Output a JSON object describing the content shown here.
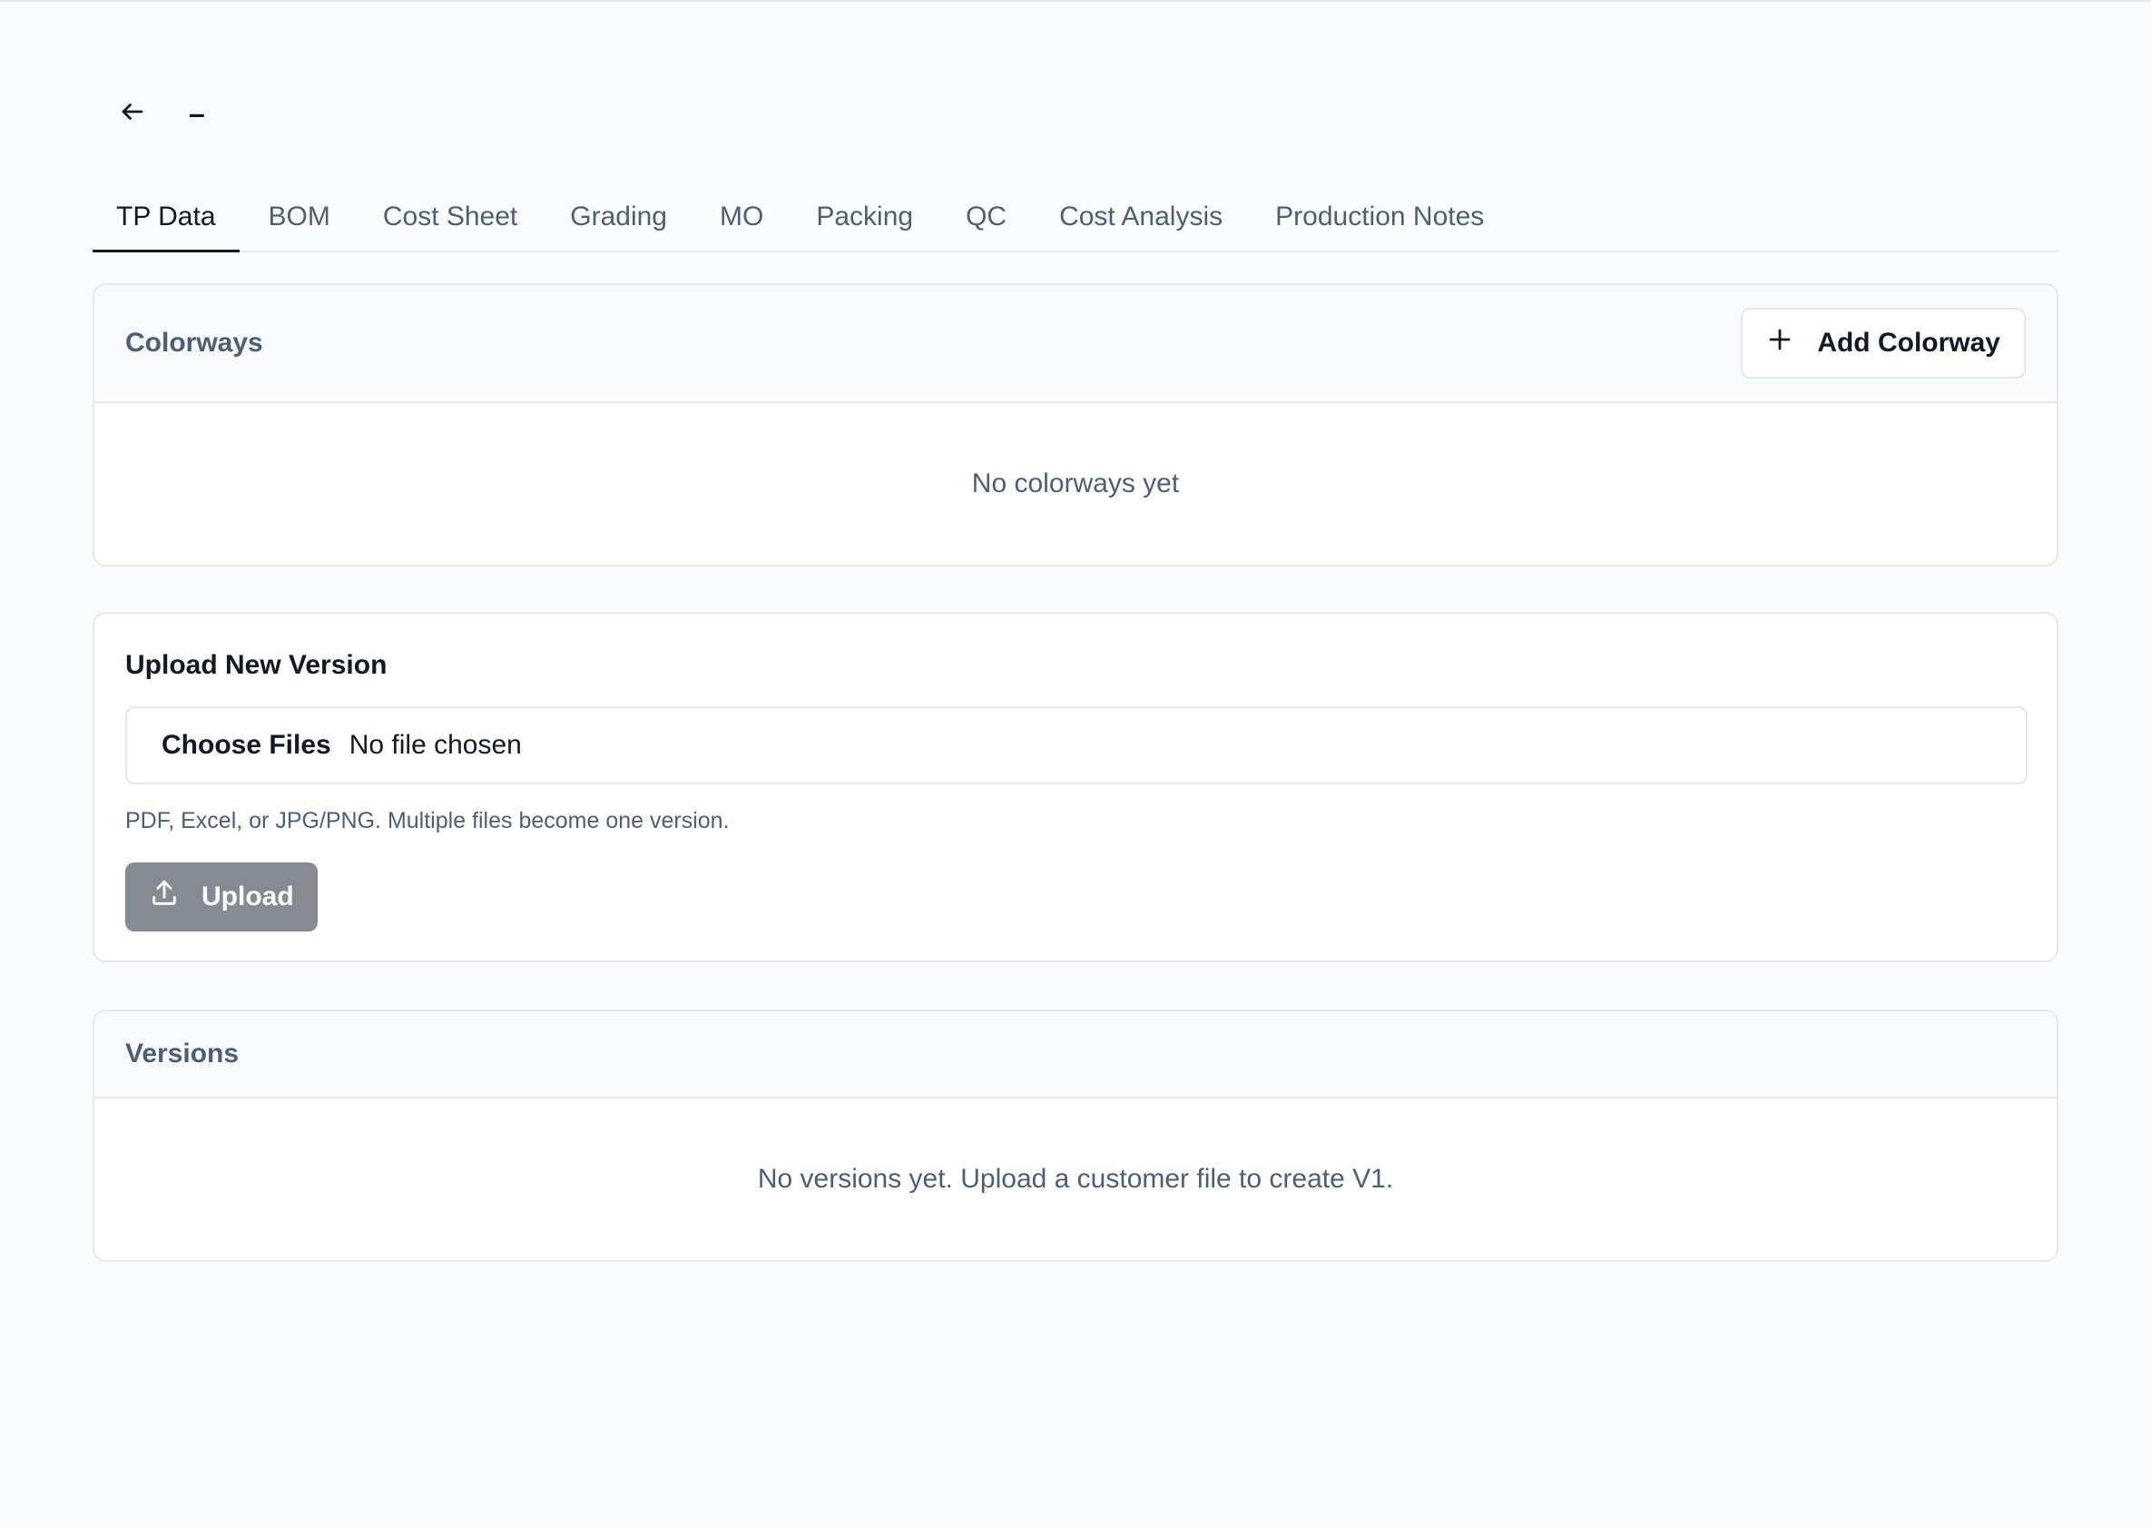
{
  "header": {
    "back_icon": "arrow-left-icon",
    "title": "–"
  },
  "tabs": [
    {
      "label": "TP Data",
      "active": true
    },
    {
      "label": "BOM",
      "active": false
    },
    {
      "label": "Cost Sheet",
      "active": false
    },
    {
      "label": "Grading",
      "active": false
    },
    {
      "label": "MO",
      "active": false
    },
    {
      "label": "Packing",
      "active": false
    },
    {
      "label": "QC",
      "active": false
    },
    {
      "label": "Cost Analysis",
      "active": false
    },
    {
      "label": "Production Notes",
      "active": false
    }
  ],
  "colorways": {
    "title": "Colorways",
    "add_button_label": "Add Colorway",
    "add_icon": "plus-icon",
    "empty_text": "No colorways yet"
  },
  "upload": {
    "title": "Upload New Version",
    "file_button_label": "Choose Files",
    "file_status": "No file chosen",
    "hint": "PDF, Excel, or JPG/PNG. Multiple files become one version.",
    "upload_button_label": "Upload",
    "upload_icon": "upload-icon"
  },
  "versions": {
    "title": "Versions",
    "empty_text": "No versions yet. Upload a customer file to create V1."
  },
  "colors": {
    "background": "#fbfcfe",
    "muted_text": "#4b5f79",
    "border": "#e5e7eb",
    "upload_button_bg": "#858a93"
  }
}
